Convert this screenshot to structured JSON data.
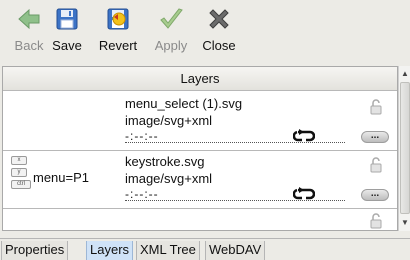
{
  "toolbar": {
    "back_label": "Back",
    "save_label": "Save",
    "revert_label": "Revert",
    "apply_label": "Apply",
    "close_label": "Close"
  },
  "table": {
    "header": "Layers",
    "rows": [
      {
        "name": "menu_select (1).svg",
        "mime": "image/svg+xml",
        "time": "-:--:--",
        "menu_label": ""
      },
      {
        "name": "keystroke.svg",
        "mime": "image/svg+xml",
        "time": "-:--:--",
        "menu_label": "menu=P1"
      }
    ],
    "more_label": "..."
  },
  "keys": [
    "x",
    "y",
    "ctrl"
  ],
  "tabs": [
    "Properties",
    "Layers",
    "XML Tree",
    "WebDAV"
  ],
  "active_tab": "Layers",
  "colors": {
    "active_tab": "#cfe2f7",
    "arrow_green": "#6fae6a",
    "save_blue": "#3c73c6"
  }
}
